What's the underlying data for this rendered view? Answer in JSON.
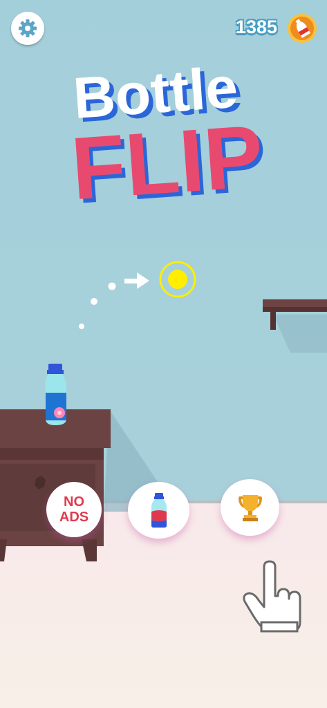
{
  "header": {
    "coins": "1385"
  },
  "logo": {
    "line1": "Bottle",
    "line2": "FLIP"
  },
  "buttons": {
    "no_ads_line1": "NO",
    "no_ads_line2": "ADS"
  },
  "icons": [
    "gear-icon",
    "coin-bottle-icon",
    "bottle-icon",
    "trophy-icon",
    "hand-pointer-icon",
    "arrow-icon",
    "target-icon"
  ],
  "colors": {
    "wall": "#a3cfdb",
    "floor": "#f8e9ea",
    "logo_white": "#ffffff",
    "logo_pink": "#e84a6f",
    "logo_shadow": "#2b66d9",
    "coin": "#f6a21b",
    "furniture": "#6b4342",
    "target": "#ffee00"
  }
}
